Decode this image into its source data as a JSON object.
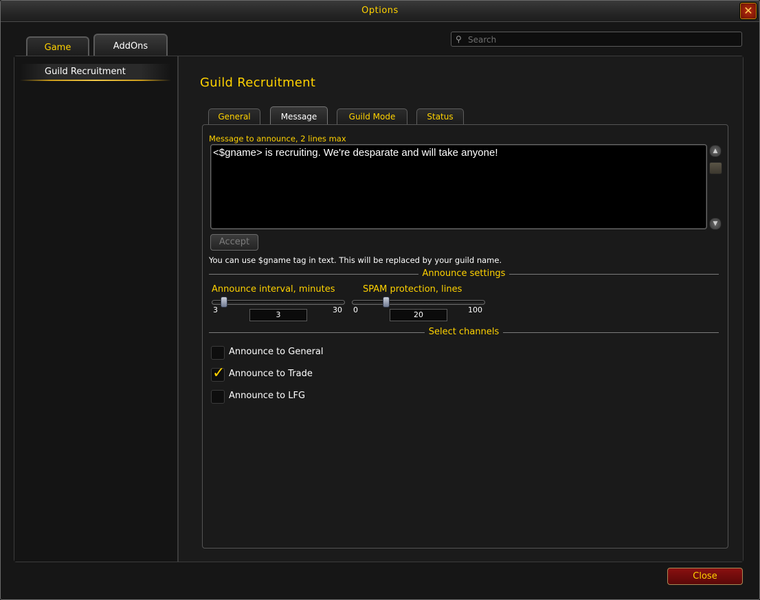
{
  "window": {
    "title": "Options"
  },
  "top_tabs": [
    {
      "label": "Game"
    },
    {
      "label": "AddOns"
    }
  ],
  "search": {
    "placeholder": "Search",
    "value": ""
  },
  "sidebar": {
    "items": [
      {
        "label": "Guild Recruitment",
        "selected": true
      }
    ]
  },
  "page": {
    "title": "Guild Recruitment"
  },
  "sub_tabs": [
    {
      "label": "General"
    },
    {
      "label": "Message",
      "active": true
    },
    {
      "label": "Guild Mode"
    },
    {
      "label": "Status"
    }
  ],
  "message": {
    "label": "Message to announce, 2 lines max",
    "text": "<$gname> is recruiting. We're desparate and will take anyone!",
    "accept_label": "Accept",
    "hint": "You can use $gname tag in text. This will be replaced by your guild name."
  },
  "announce_settings": {
    "title": "Announce settings",
    "interval": {
      "label": "Announce interval, minutes",
      "min": "3",
      "max": "30",
      "value": "3"
    },
    "spam": {
      "label": "SPAM protection, lines",
      "min": "0",
      "max": "100",
      "value": "20"
    }
  },
  "channels": {
    "title": "Select channels",
    "items": [
      {
        "label": "Announce to General",
        "checked": false
      },
      {
        "label": "Announce to Trade",
        "checked": true
      },
      {
        "label": "Announce to LFG",
        "checked": false
      }
    ]
  },
  "footer": {
    "close_label": "Close"
  },
  "colors": {
    "gold": "#ffd200",
    "panel": "#1a1a1a",
    "close_button": "#8a1010"
  }
}
